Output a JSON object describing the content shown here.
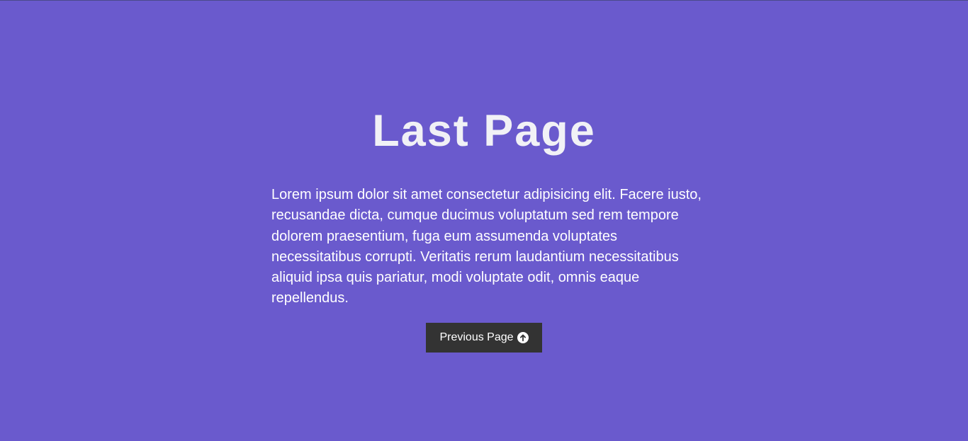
{
  "page": {
    "title": "Last Page",
    "body": "Lorem ipsum dolor sit amet consectetur adipisicing elit. Facere iusto, recusandae dicta, cumque ducimus voluptatum sed rem tempore dolorem praesentium, fuga eum assumenda voluptates necessitatibus corrupti. Veritatis rerum laudantium necessitatibus aliquid ipsa quis pariatur, modi voluptate odit, omnis eaque repellendus."
  },
  "button": {
    "label": "Previous Page",
    "icon": "arrow-up-circle-icon"
  },
  "colors": {
    "background": "#6a5acd",
    "button_bg": "#333333",
    "text": "#ffffff"
  }
}
